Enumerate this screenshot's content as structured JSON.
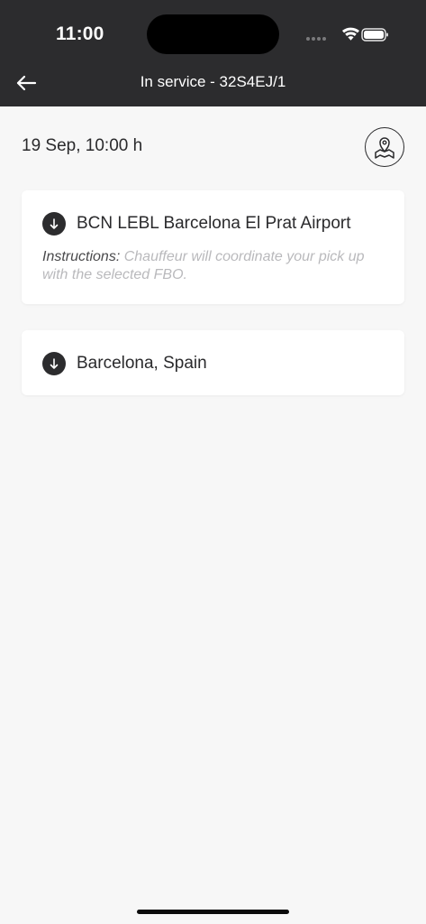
{
  "status_bar": {
    "time": "11:00"
  },
  "nav": {
    "title": "In service - 32S4EJ/1",
    "back_icon": "arrow-left-icon"
  },
  "service": {
    "date": "19 Sep, 10:00 h",
    "map_icon": "map-pin-icon"
  },
  "stops": [
    {
      "label": "BCN LEBL Barcelona El Prat Airport",
      "instructions_label": "Instructions:",
      "instructions_text": "Chauffeur will coordinate your pick up with the selected FBO."
    },
    {
      "label": "Barcelona, Spain"
    }
  ],
  "colors": {
    "header_bg": "#2c2c2e",
    "page_bg": "#f7f7f7",
    "card_bg": "#ffffff",
    "instructions_text": "#b9b9bc"
  }
}
